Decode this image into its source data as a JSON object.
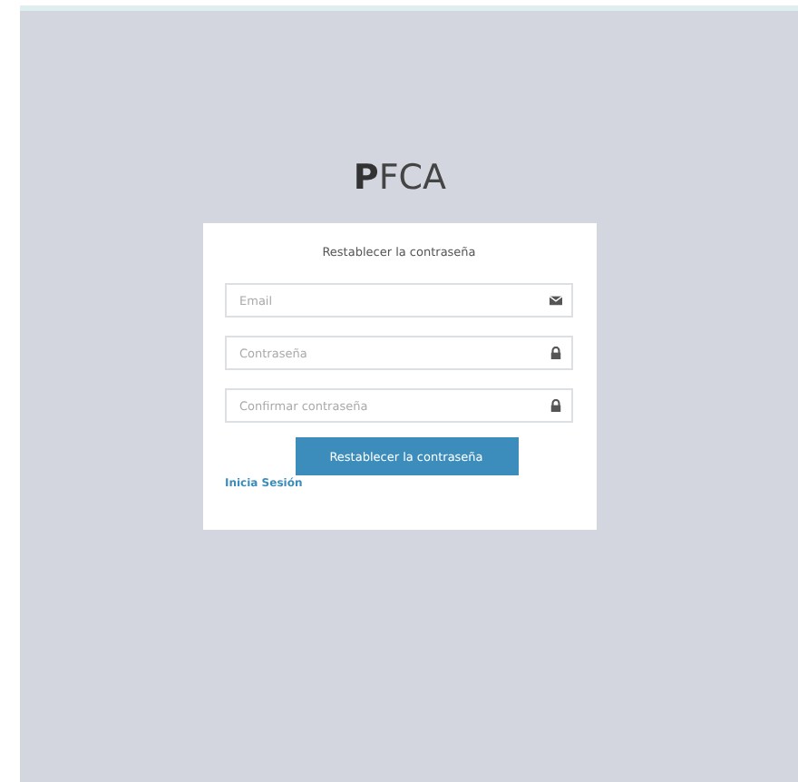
{
  "logo": "**P**FCA",
  "form": {
    "title": "Restablecer la contraseña",
    "fields": [
      {
        "placeholder": "Email",
        "kind": "email"
      },
      {
        "placeholder": "Contraseña",
        "kind": "password"
      },
      {
        "placeholder": "Confirmar contraseña",
        "kind": "password"
      }
    ],
    "submit": "Restablecer la contraseña",
    "link": "Inicia Sesión"
  }
}
